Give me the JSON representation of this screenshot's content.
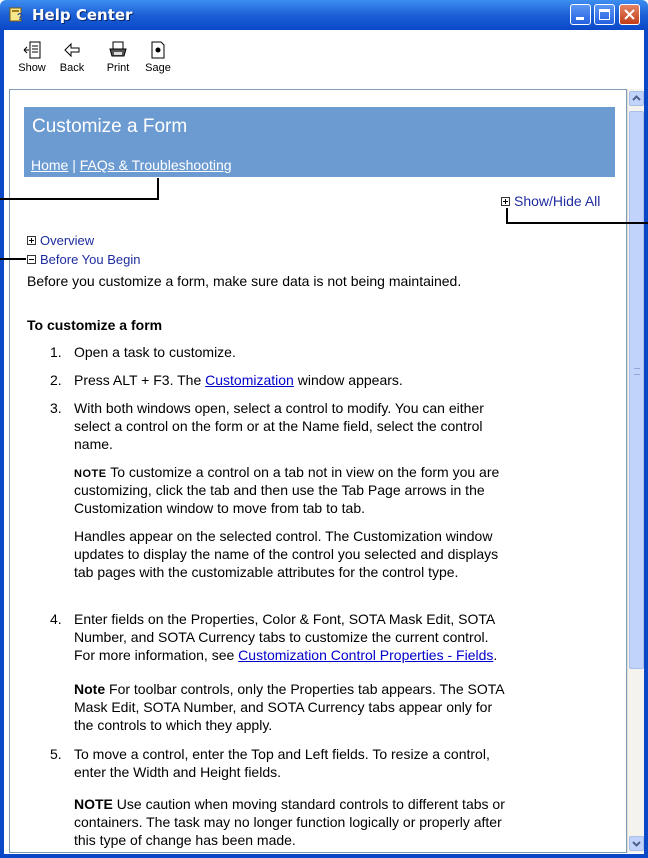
{
  "window": {
    "title": "Help Center"
  },
  "toolbar": {
    "show_label": "Show",
    "back_label": "Back",
    "print_label": "Print",
    "sage_label": "Sage"
  },
  "banner": {
    "title": "Customize a Form",
    "home_link": "Home",
    "separator": "|",
    "faq_link": "FAQs & Troubleshooting"
  },
  "show_hide_all": "Show/Hide All",
  "sections": {
    "overview": "Overview",
    "before_you_begin": "Before You Begin",
    "before_text": "Before you customize a form, make sure data is not being maintained."
  },
  "procedure": {
    "heading": "To customize a form",
    "step1_num": "1.",
    "step1": "Open a task to customize.",
    "step2_num": "2.",
    "step2_pre": "Press ALT + F3. The ",
    "step2_link": "Customization",
    "step2_post": " window appears.",
    "step3_num": "3.",
    "step3_line1": "With both windows open, select a control to modify. You can either",
    "step3_line2": "select a control on the form or at the Name field, select the control",
    "step3_line3": "name.",
    "note1_tag": "NOTE",
    "note1_line1": " To customize a control on a tab not in view on the form you are",
    "note1_line2": "customizing, click the tab and then use the Tab Page arrows in the",
    "note1_line3": "Customization window to move from tab to tab.",
    "handles_line1": "Handles appear on the selected control. The Customization window",
    "handles_line2": "updates to display the name of the control you selected and displays",
    "handles_line3": "tab pages with the customizable attributes for the control type.",
    "step4_num": "4.",
    "step4_line1": "Enter fields on the Properties, Color & Font, SOTA Mask Edit, SOTA",
    "step4_line2": "Number, and SOTA Currency tabs to customize the current control.",
    "step4_line3_pre": "For more information, see ",
    "step4_link": "Customization Control Properties - Fields",
    "step4_line3_post": ".",
    "note2_tag": "Note",
    "note2_line1": " For toolbar controls, only the Properties tab appears. The SOTA",
    "note2_line2": "Mask Edit, SOTA Number, and SOTA Currency tabs appear only for",
    "note2_line3": "the controls to which they apply.",
    "step5_num": "5.",
    "step5_line1": "To move a control, enter the Top and Left fields. To resize a control,",
    "step5_line2": "enter the Width and Height fields.",
    "note3_tag": "NOTE",
    "note3_line1": " Use caution when moving standard controls to different tabs or",
    "note3_line2": "containers. The task may no longer function logically or properly after",
    "note3_line3": "this type of change has been made."
  },
  "colors": {
    "titlebar": "#1c5fd6",
    "banner": "#6c9bd1",
    "link": "#0000cc",
    "expander": "#1e2c9f"
  }
}
